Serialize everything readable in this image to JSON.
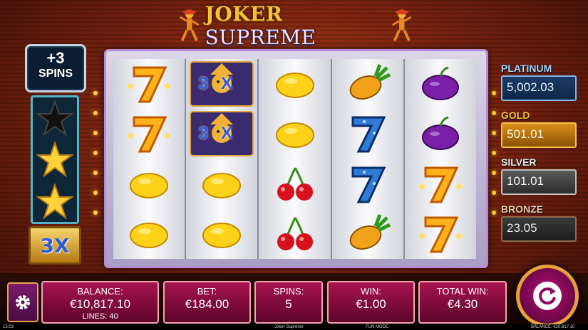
{
  "game": {
    "title_part1": "JOKER",
    "title_part2": "SUPREME"
  },
  "free_spins": {
    "count": "+3",
    "label": "SPINS"
  },
  "stars": [
    {
      "state": "empty",
      "icon": "star-dark-icon"
    },
    {
      "state": "lit",
      "icon": "star-gold-icon"
    },
    {
      "state": "lit",
      "icon": "star-gold-icon"
    }
  ],
  "multiplier": "3X",
  "reels": [
    [
      "seven",
      "seven",
      "lemon",
      "lemon"
    ],
    [
      "joker",
      "joker",
      "lemon",
      "lemon"
    ],
    [
      "lemon",
      "lemon",
      "cherry",
      "cherry"
    ],
    [
      "pineapple",
      "seven-blue",
      "seven-blue",
      "pineapple"
    ],
    [
      "plum",
      "plum",
      "seven",
      "seven"
    ]
  ],
  "joker_label": "3X",
  "jackpots": [
    {
      "name": "PLATINUM",
      "value": "5,002.03"
    },
    {
      "name": "GOLD",
      "value": "501.01"
    },
    {
      "name": "SILVER",
      "value": "101.01"
    },
    {
      "name": "BRONZE",
      "value": "23.05"
    }
  ],
  "panel": {
    "balance_label": "BALANCE:",
    "balance_value": "€10,817.10",
    "lines": "LINES: 40",
    "bet_label": "BET:",
    "bet_value": "€184.00",
    "spins_label": "SPINS:",
    "spins_value": "5",
    "win_label": "WIN:",
    "win_value": "€1.00",
    "total_win_label": "TOTAL WIN:",
    "total_win_value": "€4.30"
  },
  "footer": {
    "time": "15:03",
    "game_name": "Joker Supreme",
    "mode": "FUN MODE",
    "balance": "BALANCE: €10,817.10"
  },
  "colors": {
    "accent_gold": "#e6a13a",
    "panel_magenta": "#a8134e",
    "background_red": "#7c2410"
  }
}
